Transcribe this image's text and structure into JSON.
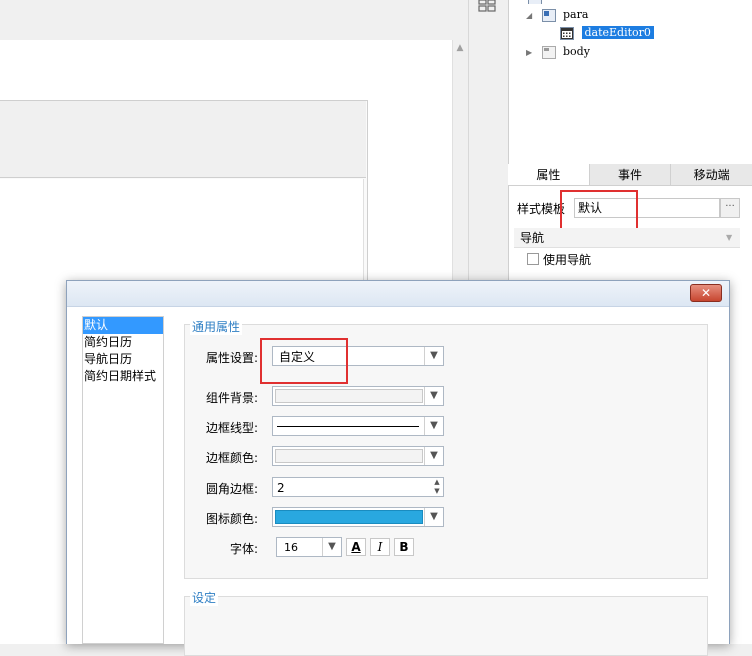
{
  "tree": {
    "node_para": "para",
    "node_date_editor": "dateEditor0",
    "node_body": "body"
  },
  "props_panel": {
    "tabs": [
      "属性",
      "事件",
      "移动端"
    ],
    "style_template_label": "样式模板",
    "style_template_value": "默认",
    "style_more": "···",
    "nav_section": "导航",
    "use_nav_label": "使用导航"
  },
  "dialog": {
    "close_glyph": "✕",
    "list_items": [
      "默认",
      "简约日历",
      "导航日历",
      "简约日期样式"
    ],
    "selected_index": 0,
    "general_group_title": "通用属性",
    "settings_group_title": "设定",
    "props": {
      "attr_setting_label": "属性设置:",
      "attr_setting_value": "自定义",
      "bg_label": "组件背景:",
      "border_style_label": "边框线型:",
      "border_color_label": "边框颜色:",
      "radius_label": "圆角边框:",
      "radius_value": "2",
      "icon_color_label": "图标颜色:",
      "icon_color": "#29a8e0",
      "font_label": "字体:",
      "font_size": "16",
      "font_color_btn": "A",
      "italic_btn": "I",
      "bold_btn": "B"
    }
  },
  "colors": {
    "highlight_red": "#e03030",
    "selection_blue": "#3399ff",
    "group_title_blue": "#2f7fc4"
  }
}
